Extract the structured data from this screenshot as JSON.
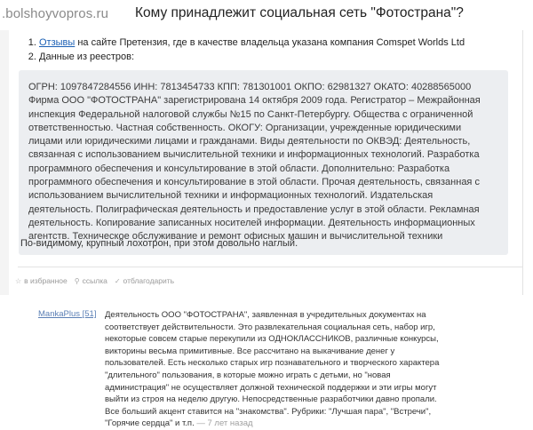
{
  "header": {
    "site": ".bolshoyvopros.ru",
    "title": "Кому принадлежит социальная сеть \"Фотострана\"?"
  },
  "answer": {
    "refs": [
      {
        "link": "Отзывы",
        "text": " на сайте Претензия, где в качестве владельца указана компания Comspet Worlds Ltd"
      },
      {
        "link": "",
        "text": "Данные из реестров:"
      }
    ],
    "quote": "ОГРН: 1097847284556 ИНН: 7813454733 КПП: 781301001 ОКПО: 62981327 ОКАТО: 40288565000 Фирма ООО \"ФОТОСТРАНА\" зарегистрирована 14 октября 2009 года. Регистратор – Межрайонная инспекция Федеральной налоговой службы №15 по Санкт-Петербургу. Общества с ограниченной ответственностью. Частная собственность. ОКОГУ: Организации, учрежденные юридическими лицами или юридическими лицами и гражданами. Виды деятельности по ОКВЭД: Деятельность, связанная с использованием вычислительной техники и информационных технологий. Разработка программного обеспечения и консультирование в этой области. Дополнительно: Разработка программного обеспечения и консультирование в этой области. Прочая деятельность, связанная с использованием вычислительной техники и информационных технологий. Издательская деятельность. Полиграфическая деятельность и предоставление услуг в этой области. Рекламная деятельность. Копирование записанных носителей информации. Деятельность информационных агентств. Техническое обслуживание и ремонт офисных машин и вычислительной техники",
    "verdict": "По-видимому, крупный лохотрон, при этом довольно наглый.",
    "actions": [
      {
        "icon": "star-icon",
        "glyph": "☆",
        "label": "в избранное"
      },
      {
        "icon": "link-icon",
        "glyph": "⚲",
        "label": "ссылка"
      },
      {
        "icon": "thumb-icon",
        "glyph": "✓",
        "label": "отблагодарить"
      }
    ]
  },
  "comment": {
    "author": "MankaPlus [51]",
    "text": "Деятельность ООО \"ФОТОСТРАНА\", заявленная в учредительных документах на соответствует действительности. Это развлекательная социальная сеть, набор игр, некоторые совсем старые перекупили из ОДНОКЛАССНИКОВ, различные конкурсы, викторины весьма примитивные. Все рассчитано на выкачивание денег у пользователей. Есть несколько старых игр познавательного и творческого характера \"длительного\" пользования, в которые можно играть с детьми, но \"новая администрация\" не осуществляет должной технической поддержки и эти игры могут выйти из строя на неделю другую. Непосредственные разработчики давно пропали. Все больший акцент ставится на \"знакомства\". Рубрики: \"Лучшая пара\", \"Встречи\", \"Горячие сердца\" и т.п.",
    "time": " — 7 лет назад"
  }
}
